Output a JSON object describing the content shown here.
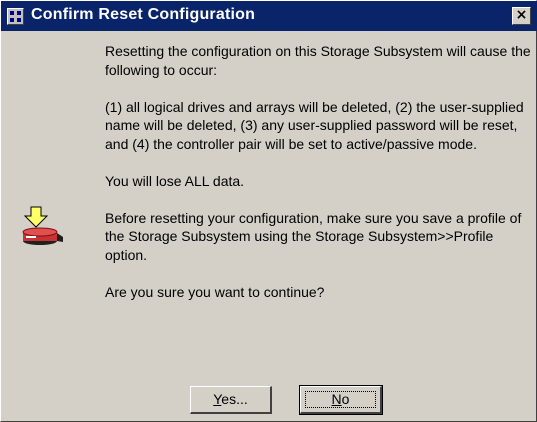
{
  "window": {
    "title": "Confirm Reset Configuration",
    "close_glyph": "×",
    "title_icon": "storage-manager-icon"
  },
  "dialog": {
    "icon": "warning-reset-icon",
    "paragraphs": [
      "Resetting the configuration on this Storage Subsystem will cause the following to occur:",
      "(1) all logical drives and arrays will be deleted, (2) the user-supplied name will be deleted, (3) any user-supplied password will be reset, and (4) the controller pair will be set to active/passive mode.",
      "You will lose ALL data.",
      "Before resetting your configuration, make sure you save a profile of the Storage Subsystem using the Storage Subsystem>>Profile option.",
      "Are you sure you want to continue?"
    ]
  },
  "buttons": {
    "yes": {
      "mnemonic": "Y",
      "rest": "es..."
    },
    "no": {
      "mnemonic": "N",
      "rest": "o"
    }
  },
  "colors": {
    "titlebar": "#0a246a",
    "dialog_bg": "#d4d0c8",
    "arrow": "#ffff66",
    "drive": "#d04040"
  }
}
